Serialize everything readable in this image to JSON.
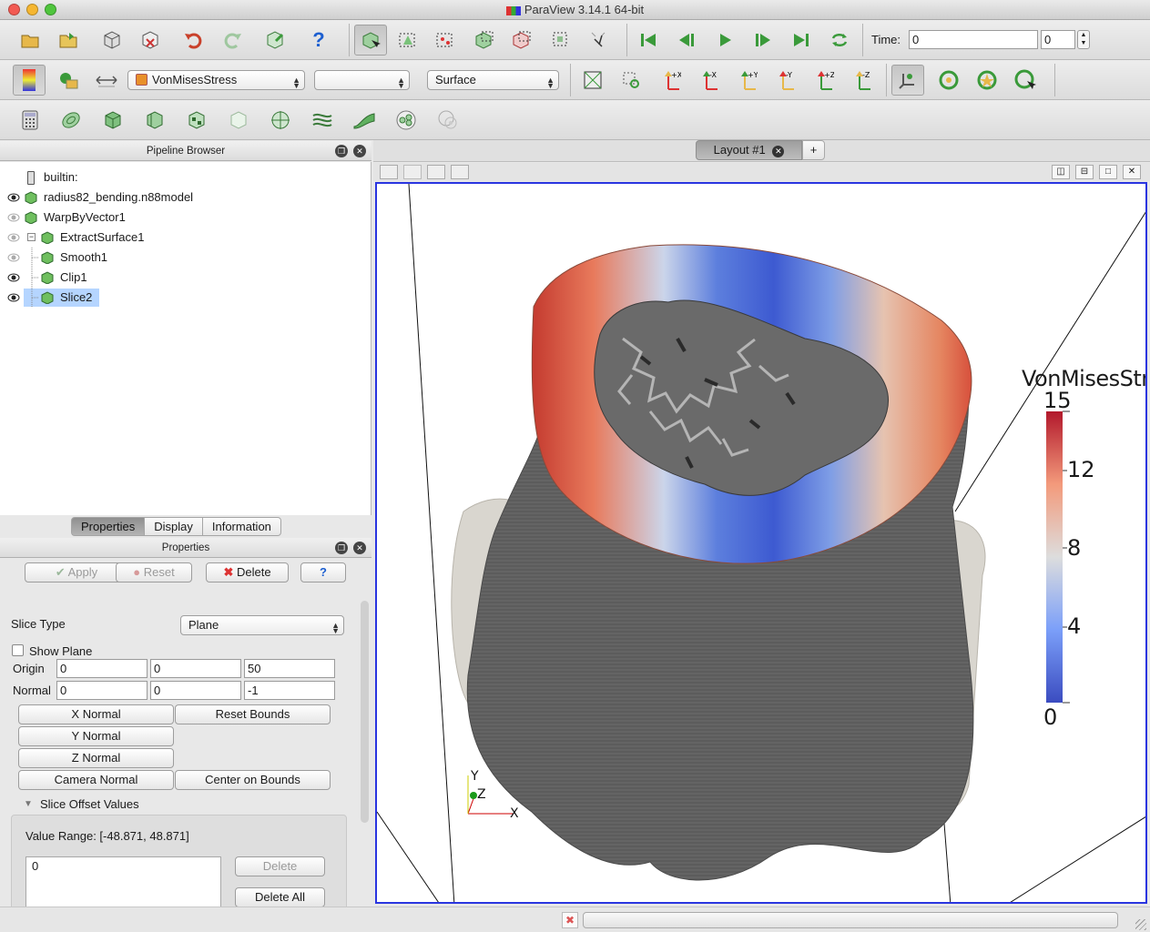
{
  "window": {
    "title": "ParaView 3.14.1 64-bit"
  },
  "toolbar_main": {
    "icons": [
      "open-file-icon",
      "load-state-icon",
      "save-data-icon",
      "save-state-icon",
      "undo-icon",
      "redo-icon",
      "connect-icon",
      "help-icon",
      "interact-icon",
      "select-cells-on-icon",
      "select-points-on-icon",
      "select-cells-through-icon",
      "select-points-through-icon",
      "select-block-icon",
      "clear-selection-icon",
      "first-frame-icon",
      "previous-frame-icon",
      "play-icon",
      "next-frame-icon",
      "last-frame-icon",
      "loop-icon"
    ],
    "time_label": "Time:",
    "time_value": "0",
    "time_index": "0"
  },
  "toolbar_display": {
    "color_array": "VonMisesStress",
    "component": "",
    "representation": "Surface"
  },
  "pipeline": {
    "header": "Pipeline Browser",
    "items": [
      {
        "label": "builtin:",
        "visible": "none"
      },
      {
        "label": "radius82_bending.n88model",
        "visible": "on"
      },
      {
        "label": "WarpByVector1",
        "visible": "off"
      },
      {
        "label": "ExtractSurface1",
        "visible": "off"
      },
      {
        "label": "Smooth1",
        "visible": "off"
      },
      {
        "label": "Clip1",
        "visible": "on"
      },
      {
        "label": "Slice2",
        "visible": "on"
      }
    ]
  },
  "tabs": [
    "Properties",
    "Display",
    "Information"
  ],
  "properties": {
    "header": "Properties",
    "apply": "Apply",
    "reset": "Reset",
    "delete": "Delete",
    "help": "?",
    "slice_type_label": "Slice Type",
    "slice_type_value": "Plane",
    "show_plane": "Show Plane",
    "origin_label": "Origin",
    "origin": [
      "0",
      "0",
      "50"
    ],
    "normal_label": "Normal",
    "normal": [
      "0",
      "0",
      "-1"
    ],
    "x_normal": "X Normal",
    "reset_bounds": "Reset Bounds",
    "y_normal": "Y Normal",
    "z_normal": "Z Normal",
    "camera_normal": "Camera Normal",
    "center_on_bounds": "Center on Bounds",
    "offset_section": "Slice Offset Values",
    "value_range": "Value Range: [-48.871, 48.871]",
    "offset_values": [
      "0"
    ],
    "delete_btn": "Delete",
    "delete_all": "Delete All"
  },
  "layout": {
    "tab": "Layout #1",
    "add": "+"
  },
  "legend": {
    "title": "VonMisesStre",
    "ticks": [
      "15",
      "12",
      "8",
      "4",
      "0"
    ],
    "colors": {
      "high": "#b2182b",
      "mid": "#dddddd",
      "low": "#3b4cc0"
    }
  },
  "axes": {
    "x": "X",
    "y": "Y",
    "z": "Z"
  }
}
